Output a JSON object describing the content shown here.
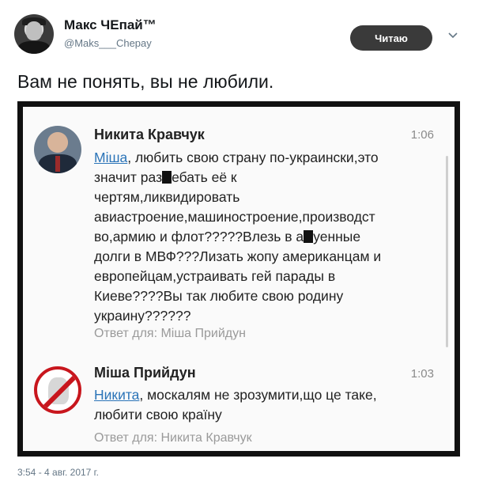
{
  "tweet": {
    "author_name": "Макс ЧЕпай™",
    "author_handle": "@Maks___Chepay",
    "follow_label": "Читаю",
    "text": "Вам не понять, вы не любили.",
    "timestamp": "3:54 - 4 авг. 2017 г."
  },
  "embedded": {
    "comments": [
      {
        "author": "Никита Кравчук",
        "time": "1:06",
        "mention": "Міша",
        "lines": [
          ", любить свою страну по-украински,это",
          "значит раз",
          "ебать её к",
          "чертям,ликвидировать",
          "авиастроение,машиностроение,производст",
          "во,армию и флот?????Влезь в а",
          "уенные",
          "долги в МВФ???Лизать жопу американцам и",
          "европейцам,устраивать гей парады в",
          "Киеве????Вы так любите свою родину",
          "украину??????"
        ],
        "reply": "Ответ для: Міша Прийдун"
      },
      {
        "author": "Міша Прийдун",
        "time": "1:03",
        "mention": "Никита",
        "lines": [
          ", москалям не зрозумити,що це таке,",
          "любити свою країну"
        ],
        "reply": "Ответ для: Никита Кравчук"
      }
    ]
  },
  "icons": {
    "chevron": "chevron-down-icon"
  },
  "colors": {
    "mention": "#2b74b8",
    "follow_button": "#3a3a3a"
  }
}
